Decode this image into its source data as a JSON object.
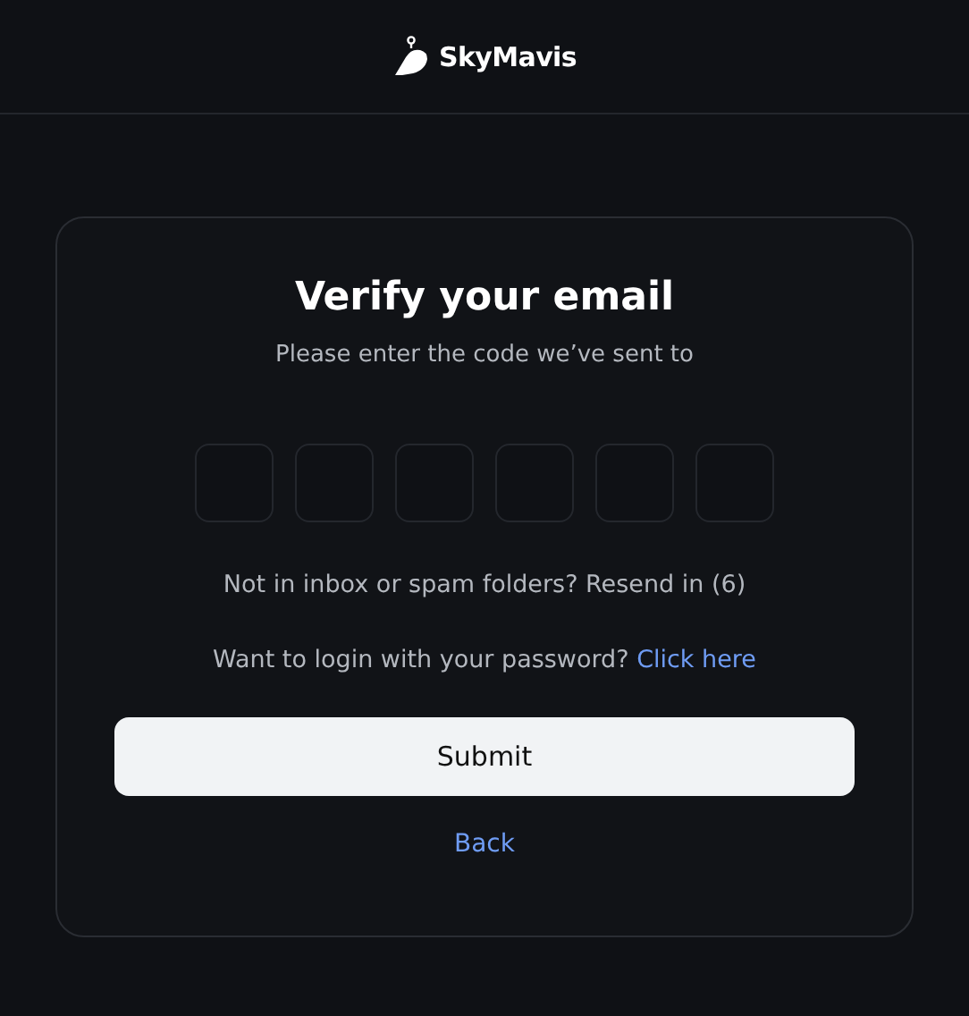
{
  "header": {
    "logo_text": "SkyMavis"
  },
  "card": {
    "title": "Verify your email",
    "subtitle": "Please enter the code we’ve sent to",
    "code_boxes": [
      {
        "filled": false
      },
      {
        "filled": false
      },
      {
        "filled": false
      },
      {
        "filled": false
      },
      {
        "filled": false
      },
      {
        "filled": false
      }
    ],
    "resend_text": "Not in inbox or spam folders? Resend in (6)",
    "password_prompt": "Want to login with your password?",
    "password_link": "Click here",
    "submit_button": "Submit",
    "back_link": "Back"
  }
}
